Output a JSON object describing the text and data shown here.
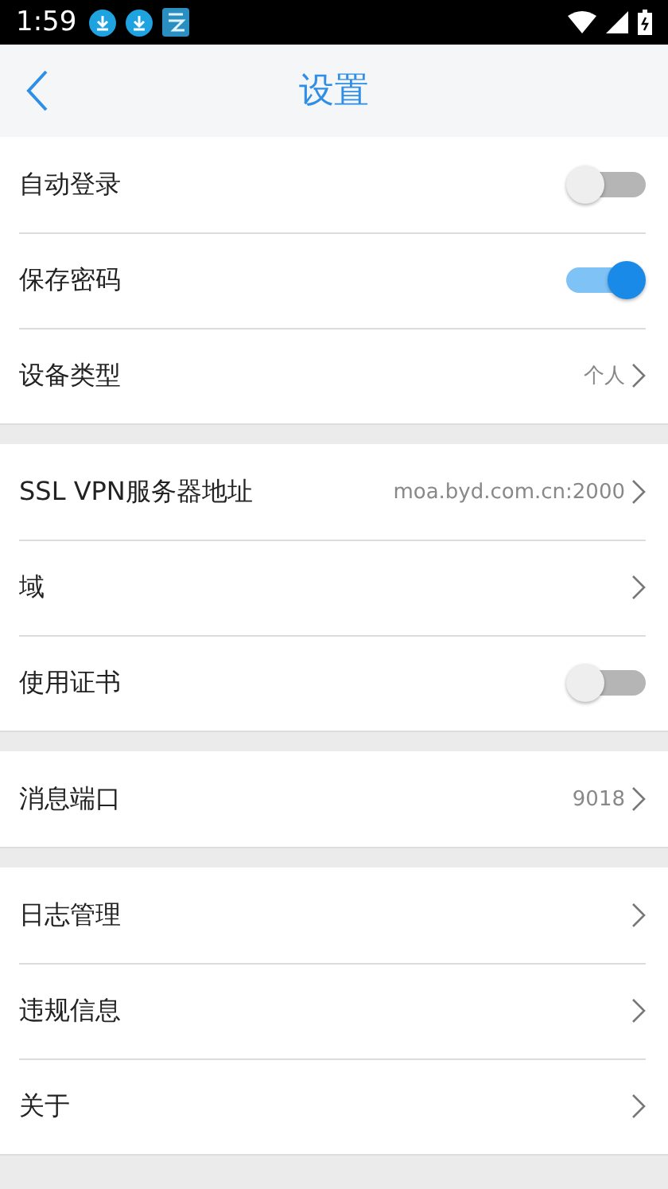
{
  "status_bar": {
    "time": "1:59"
  },
  "header": {
    "title": "设置"
  },
  "groups": [
    {
      "rows": [
        {
          "kind": "toggle",
          "label": "自动登录",
          "on": false
        },
        {
          "kind": "toggle",
          "label": "保存密码",
          "on": true
        },
        {
          "kind": "link",
          "label": "设备类型",
          "value": "个人"
        }
      ]
    },
    {
      "rows": [
        {
          "kind": "link",
          "label": "SSL VPN服务器地址",
          "value": "moa.byd.com.cn:2000"
        },
        {
          "kind": "link",
          "label": "域"
        },
        {
          "kind": "toggle",
          "label": "使用证书",
          "on": false
        }
      ]
    },
    {
      "rows": [
        {
          "kind": "link",
          "label": "消息端口",
          "value": "9018"
        }
      ]
    },
    {
      "rows": [
        {
          "kind": "link",
          "label": "日志管理"
        },
        {
          "kind": "link",
          "label": "违规信息"
        },
        {
          "kind": "link",
          "label": "关于"
        }
      ]
    }
  ]
}
